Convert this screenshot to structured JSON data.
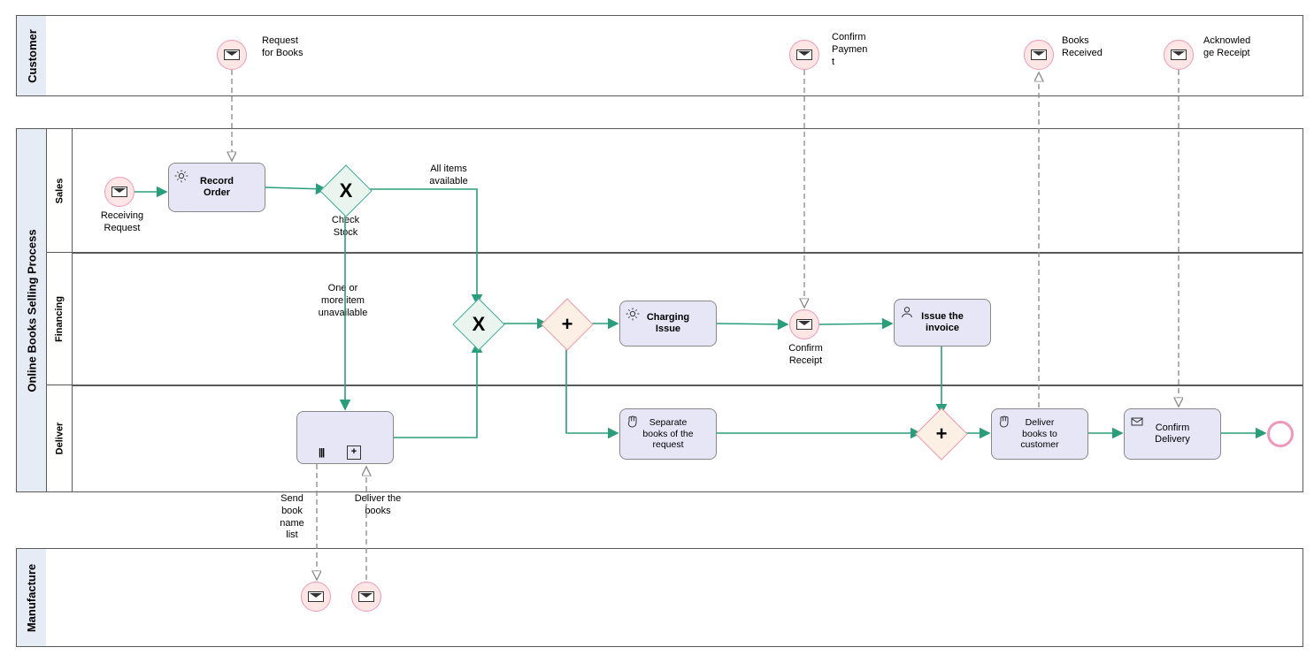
{
  "pools": {
    "customer": "Customer",
    "process": "Online Books Selling Process",
    "manufacture": "Manufacture"
  },
  "lanes": {
    "sales": "Sales",
    "financing": "Financing",
    "deliver": "Deliver"
  },
  "events": {
    "request_books": "Request\nfor Books",
    "confirm_payment": "Confirm\nPaymen\nt",
    "books_received": "Books\nReceived",
    "ack_receipt": "Acknowled\nge Receipt",
    "receiving_request": "Receiving\nRequest",
    "confirm_receipt": "Confirm\nReceipt",
    "send_book_list": "Send\nbook\nname\nlist",
    "deliver_books_msg": "Deliver the\nbooks"
  },
  "tasks": {
    "record_order": "Record\nOrder",
    "charging_issue": "Charging\nIssue",
    "issue_invoice": "Issue the\ninvoice",
    "separate_books": "Separate\nbooks of the\nrequest",
    "deliver_books": "Deliver\nbooks to\ncustomer",
    "confirm_delivery": "Confirm\nDelivery"
  },
  "gateways": {
    "check_stock": "Check\nStock",
    "all_items": "All items\navailable",
    "one_more": "One or\nmore item\nunavailable"
  }
}
